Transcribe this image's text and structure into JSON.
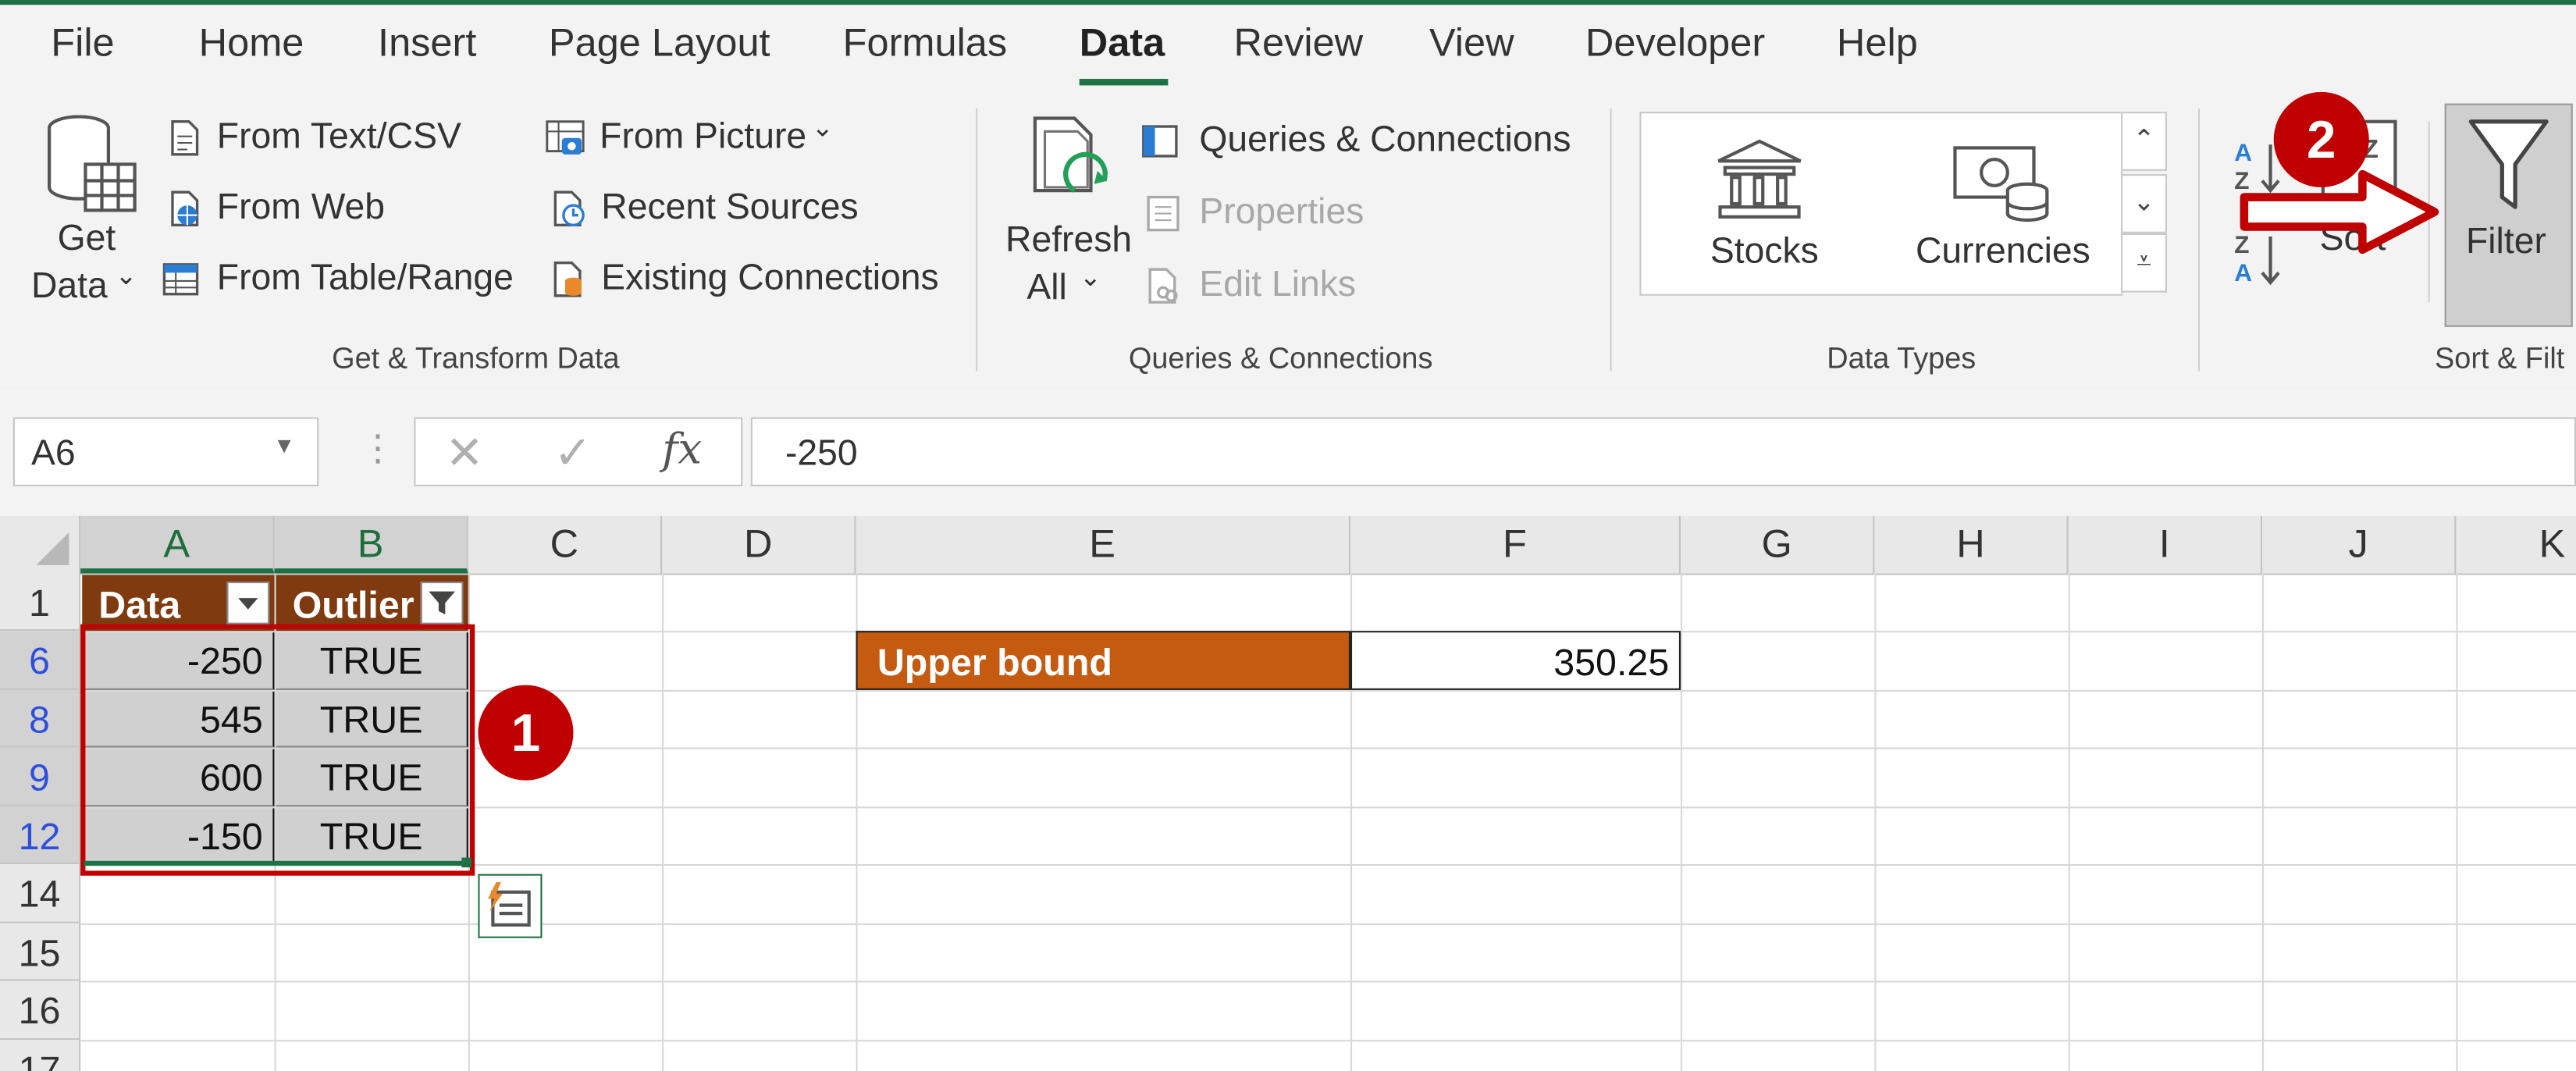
{
  "tabs": [
    "File",
    "Home",
    "Insert",
    "Page Layout",
    "Formulas",
    "Data",
    "Review",
    "View",
    "Developer",
    "Help"
  ],
  "active_tab": "Data",
  "ribbon": {
    "get_data": {
      "line1": "Get",
      "line2": "Data"
    },
    "get_transform": {
      "from_text_csv": "From Text/CSV",
      "from_web": "From Web",
      "from_table_range": "From Table/Range",
      "from_picture": "From Picture",
      "recent_sources": "Recent Sources",
      "existing_connections": "Existing Connections",
      "group_label": "Get & Transform Data"
    },
    "queries": {
      "refresh_line1": "Refresh",
      "refresh_line2": "All",
      "queries_connections": "Queries & Connections",
      "properties": "Properties",
      "edit_links": "Edit Links",
      "group_label": "Queries & Connections"
    },
    "data_types": {
      "stocks": "Stocks",
      "currencies": "Currencies",
      "group_label": "Data Types"
    },
    "sort_filter": {
      "sort": "Sort",
      "filter": "Filter",
      "group_label": "Sort & Filt"
    }
  },
  "formula_bar": {
    "name_box": "A6",
    "formula": "-250"
  },
  "columns": [
    "A",
    "B",
    "C",
    "D",
    "E",
    "F",
    "G",
    "H",
    "I",
    "J",
    "K"
  ],
  "rows": [
    "1",
    "6",
    "8",
    "9",
    "12",
    "14",
    "15",
    "16",
    "17"
  ],
  "table": {
    "headers": [
      "Data",
      "Outlier"
    ],
    "rows": [
      [
        "-250",
        "TRUE"
      ],
      [
        "545",
        "TRUE"
      ],
      [
        "600",
        "TRUE"
      ],
      [
        "-150",
        "TRUE"
      ]
    ]
  },
  "upper_bound": {
    "label": "Upper bound",
    "value": "350.25"
  },
  "annotations": {
    "step1": "1",
    "step2": "2"
  },
  "colors": {
    "header_fill": "#7f3a10",
    "label_fill": "#c55a11",
    "highlight": "#c00000",
    "excel_green": "#1e7145"
  }
}
